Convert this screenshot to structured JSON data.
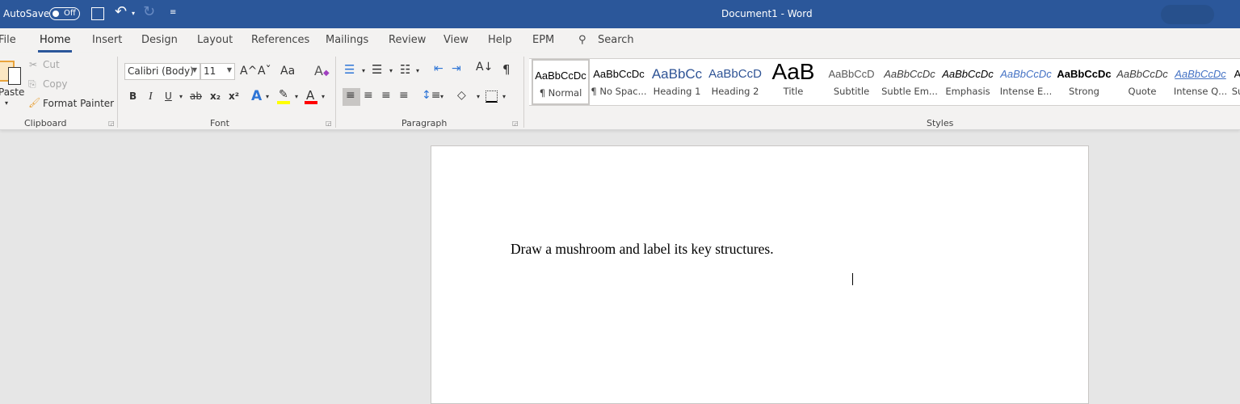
{
  "titlebar": {
    "autosave": "AutoSave",
    "autosave_state": "Off",
    "title": "Document1  -  Word"
  },
  "tabs": [
    "File",
    "Home",
    "Insert",
    "Design",
    "Layout",
    "References",
    "Mailings",
    "Review",
    "View",
    "Help",
    "EPM"
  ],
  "search": "Search",
  "clipboard": {
    "paste": "Paste",
    "cut": "Cut",
    "copy": "Copy",
    "format_painter": "Format Painter",
    "label": "Clipboard"
  },
  "font": {
    "name": "Calibri (Body)",
    "size": "11",
    "label": "Font",
    "bold": "B",
    "italic": "I",
    "underline": "U",
    "strike": "ab",
    "sub": "x₂",
    "sup": "x²",
    "case": "Aa",
    "grow": "A^",
    "shrink": "Aˇ"
  },
  "paragraph": {
    "label": "Paragraph",
    "pilcrow": "¶"
  },
  "styles": {
    "label": "Styles",
    "items": [
      {
        "preview": "AaBbCcDc",
        "name": "¶ Normal"
      },
      {
        "preview": "AaBbCcDc",
        "name": "¶ No Spac..."
      },
      {
        "preview": "AaBbCc",
        "name": "Heading 1"
      },
      {
        "preview": "AaBbCcD",
        "name": "Heading 2"
      },
      {
        "preview": "AaB",
        "name": "Title"
      },
      {
        "preview": "AaBbCcD",
        "name": "Subtitle"
      },
      {
        "preview": "AaBbCcDc",
        "name": "Subtle Em..."
      },
      {
        "preview": "AaBbCcDc",
        "name": "Emphasis"
      },
      {
        "preview": "AaBbCcDc",
        "name": "Intense E..."
      },
      {
        "preview": "AaBbCcDc",
        "name": "Strong"
      },
      {
        "preview": "AaBbCcDc",
        "name": "Quote"
      },
      {
        "preview": "AaBbCcDc",
        "name": "Intense Q..."
      },
      {
        "preview": "A",
        "name": "Su"
      }
    ]
  },
  "document": {
    "text": "Draw a mushroom and label its key structures."
  },
  "colors": {
    "brand": "#2b579a",
    "highlight": "#ffff00",
    "font_color": "#ff0000"
  }
}
